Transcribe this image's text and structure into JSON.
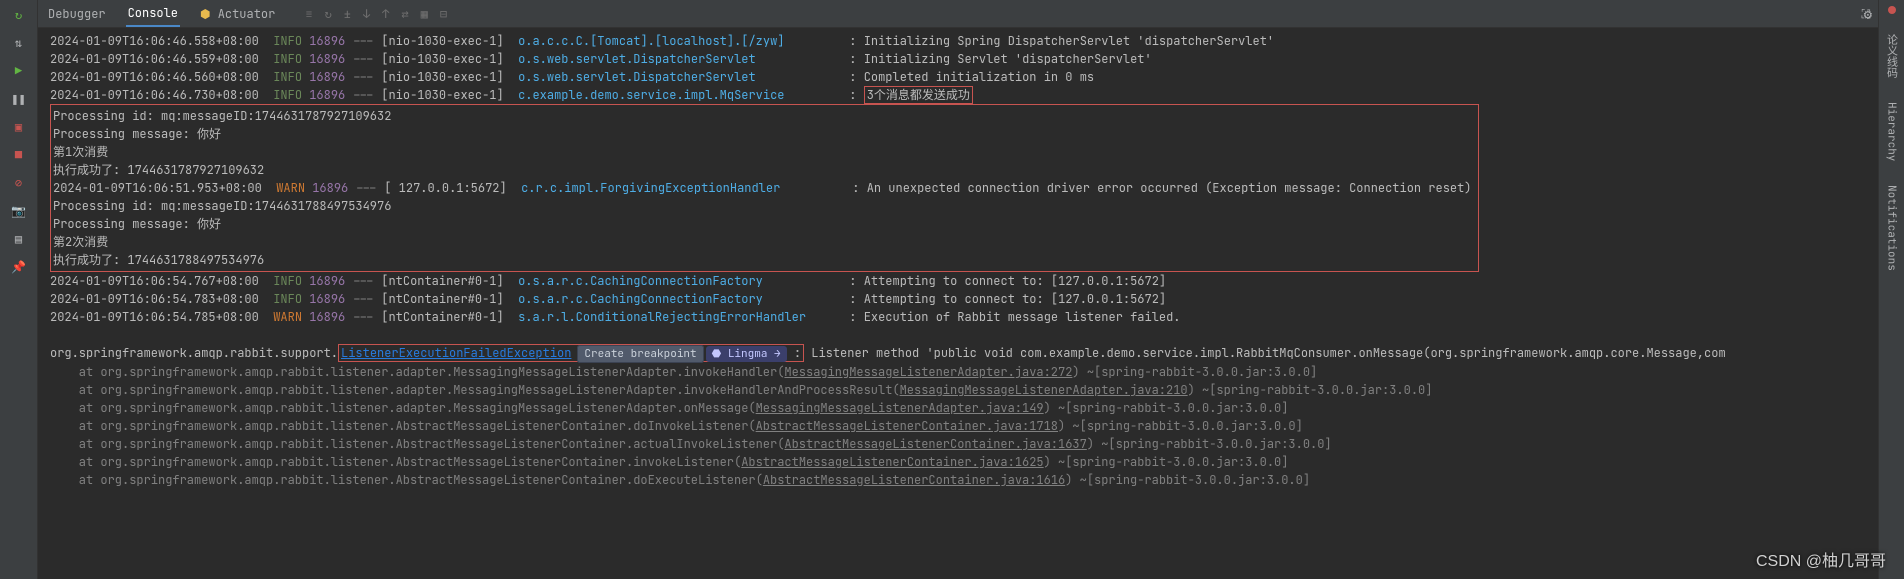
{
  "tabs": {
    "debugger": "Debugger",
    "console": "Console",
    "actuator": "Actuator"
  },
  "toolIcons": [
    "≡",
    "↻",
    "±",
    "↓",
    "↑",
    "⇄",
    "▦",
    "⊟"
  ],
  "leftRail": [
    "restart",
    "debug-tree",
    "play",
    "pause",
    "stop-all",
    "stop",
    "mute",
    "camera",
    "layout",
    "pin"
  ],
  "rightRail": {
    "red": "Red",
    "yilian": "论义线码",
    "hierarchy": "Hierarchy",
    "notifications": "Notifications"
  },
  "watermark": "CSDN @柚几哥哥",
  "lines": [
    {
      "ts": "2024-01-09T16:06:46.558+08:00",
      "lvl": "INFO",
      "pid": "16896",
      "thr": "[nio-1030-exec-1]",
      "cls": "o.a.c.c.C.[Tomcat].[localhost].[/zyw]",
      "msg": "Initializing Spring DispatcherServlet 'dispatcherServlet'"
    },
    {
      "ts": "2024-01-09T16:06:46.559+08:00",
      "lvl": "INFO",
      "pid": "16896",
      "thr": "[nio-1030-exec-1]",
      "cls": "o.s.web.servlet.DispatcherServlet",
      "msg": "Initializing Servlet 'dispatcherServlet'"
    },
    {
      "ts": "2024-01-09T16:06:46.560+08:00",
      "lvl": "INFO",
      "pid": "16896",
      "thr": "[nio-1030-exec-1]",
      "cls": "o.s.web.servlet.DispatcherServlet",
      "msg": "Completed initialization in 0 ms"
    },
    {
      "ts": "2024-01-09T16:06:46.730+08:00",
      "lvl": "INFO",
      "pid": "16896",
      "thr": "[nio-1030-exec-1]",
      "cls": "c.example.demo.service.impl.MqService",
      "msg": "3个消息都发送成功",
      "redmsg": true
    }
  ],
  "block1": [
    "Processing id: mq:messageID:1744631787927109632",
    "Processing message: 你好",
    "第1次消费",
    "执行成功了: 1744631787927109632"
  ],
  "warnLine": {
    "ts": "2024-01-09T16:06:51.953+08:00",
    "lvl": "WARN",
    "pid": "16896",
    "thr": "[ 127.0.0.1:5672]",
    "cls": "c.r.c.impl.ForgivingExceptionHandler",
    "msg": "An unexpected connection driver error occurred (Exception message: Connection reset)"
  },
  "block2": [
    "Processing id: mq:messageID:1744631788497534976",
    "Processing message: 你好",
    "第2次消费",
    "执行成功了: 1744631788497534976"
  ],
  "after": [
    {
      "ts": "2024-01-09T16:06:54.767+08:00",
      "lvl": "INFO",
      "pid": "16896",
      "thr": "[ntContainer#0-1]",
      "cls": "o.s.a.r.c.CachingConnectionFactory",
      "msg": "Attempting to connect to: [127.0.0.1:5672]"
    },
    {
      "ts": "2024-01-09T16:06:54.783+08:00",
      "lvl": "INFO",
      "pid": "16896",
      "thr": "[ntContainer#0-1]",
      "cls": "o.s.a.r.c.CachingConnectionFactory",
      "msg": "Attempting to connect to: [127.0.0.1:5672]"
    },
    {
      "ts": "2024-01-09T16:06:54.785+08:00",
      "lvl": "WARN",
      "pid": "16896",
      "thr": "[ntContainer#0-1]",
      "cls": "s.a.r.l.ConditionalRejectingErrorHandler",
      "msg": "Execution of Rabbit message listener failed."
    }
  ],
  "ex": {
    "pre": "org.springframework.amqp.rabbit.support.",
    "type": "ListenerExecutionFailedException",
    "badge": "Create breakpoint",
    "lingma": "Lingma →",
    "colon": ":",
    "tail": "Listener method 'public void com.example.demo.service.impl.RabbitMqConsumer.onMessage(org.springframework.amqp.core.Message,com"
  },
  "stack": [
    {
      "pre": "    at org.springframework.amqp.rabbit.listener.adapter.MessagingMessageListenerAdapter.invokeHandler(",
      "link": "MessagingMessageListenerAdapter.java:272",
      "suf": ") ~[spring-rabbit-3.0.0.jar:3.0.0]"
    },
    {
      "pre": "    at org.springframework.amqp.rabbit.listener.adapter.MessagingMessageListenerAdapter.invokeHandlerAndProcessResult(",
      "link": "MessagingMessageListenerAdapter.java:210",
      "suf": ") ~[spring-rabbit-3.0.0.jar:3.0.0]"
    },
    {
      "pre": "    at org.springframework.amqp.rabbit.listener.adapter.MessagingMessageListenerAdapter.onMessage(",
      "link": "MessagingMessageListenerAdapter.java:149",
      "suf": ") ~[spring-rabbit-3.0.0.jar:3.0.0]"
    },
    {
      "pre": "    at org.springframework.amqp.rabbit.listener.AbstractMessageListenerContainer.doInvokeListener(",
      "link": "AbstractMessageListenerContainer.java:1718",
      "suf": ") ~[spring-rabbit-3.0.0.jar:3.0.0]"
    },
    {
      "pre": "    at org.springframework.amqp.rabbit.listener.AbstractMessageListenerContainer.actualInvokeListener(",
      "link": "AbstractMessageListenerContainer.java:1637",
      "suf": ") ~[spring-rabbit-3.0.0.jar:3.0.0]"
    },
    {
      "pre": "    at org.springframework.amqp.rabbit.listener.AbstractMessageListenerContainer.invokeListener(",
      "link": "AbstractMessageListenerContainer.java:1625",
      "suf": ") ~[spring-rabbit-3.0.0.jar:3.0.0]"
    },
    {
      "pre": "    at org.springframework.amqp.rabbit.listener.AbstractMessageListenerContainer.doExecuteListener(",
      "link": "AbstractMessageListenerContainer.java:1616",
      "suf": ") ~[spring-rabbit-3.0.0.jar:3.0.0]"
    }
  ]
}
